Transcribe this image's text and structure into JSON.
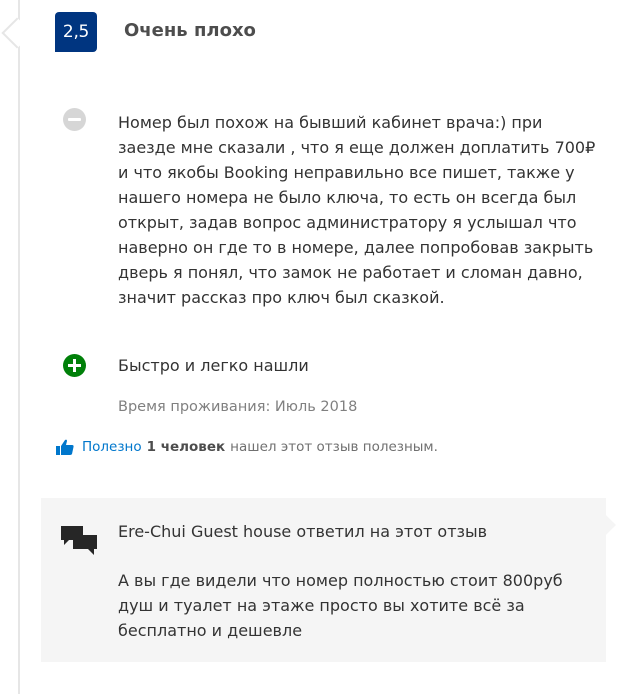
{
  "review": {
    "score": "2,5",
    "score_word": "Очень плохо",
    "negative": "Номер был похож на бывший кабинет врача:) при заезде мне сказали , что я еще должен доплатить 700₽ и что якобы Booking неправильно все пишет, также у нашего номера не было ключа, то есть он всегда был открыт, задав вопрос администратору я услышал что наверно он где то в номере, далее попробовав закрыть дверь я понял, что замок не работает и сломан давно, значит рассказ про ключ был сказкой.",
    "positive": "Быстро и легко нашли",
    "stay_date": "Время проживания: Июль 2018",
    "icons": {
      "negative": "minus-circle-icon",
      "positive": "plus-circle-icon"
    }
  },
  "helpful": {
    "link_label": "Полезно",
    "count": "1 человек",
    "suffix": "нашел этот отзыв полезным.",
    "icon": "thumbs-up-icon"
  },
  "reply": {
    "title": "Ere-Chui Guest house ответил на этот отзыв",
    "text": "А вы где видели что номер полностью стоит 800руб душ и туалет на этаже просто вы хотите всё за бесплатно и дешевле",
    "icon": "chat-bubbles-icon"
  },
  "colors": {
    "score_badge": "#003580",
    "positive": "#008009",
    "negative": "#d6d6d6",
    "link": "#0077cc",
    "reply_bg": "#f5f5f5"
  }
}
